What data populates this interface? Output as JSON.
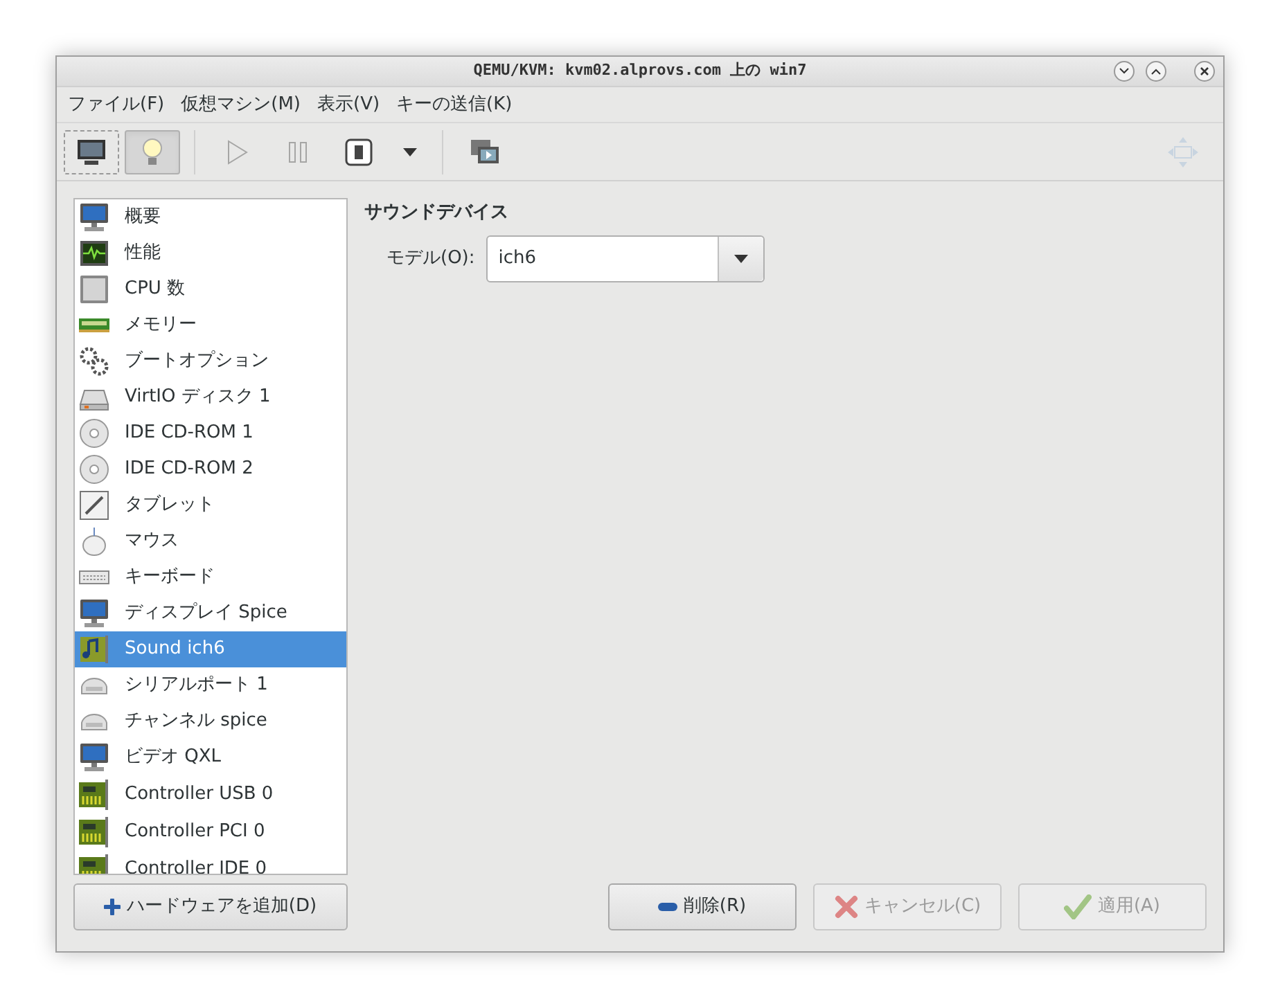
{
  "window": {
    "title": "QEMU/KVM: kvm02.alprovs.com 上の win7"
  },
  "menu": [
    "ファイル(F)",
    "仮想マシン(M)",
    "表示(V)",
    "キーの送信(K)"
  ],
  "toolbar": [
    {
      "kind": "console",
      "selected": false,
      "disabled": false
    },
    {
      "kind": "details",
      "selected": true,
      "disabled": false
    },
    {
      "kind": "run",
      "selected": false,
      "disabled": true
    },
    {
      "kind": "pause",
      "selected": false,
      "disabled": true
    },
    {
      "kind": "shutdown",
      "selected": false,
      "disabled": false
    },
    {
      "kind": "dropdown",
      "selected": false,
      "disabled": false
    },
    {
      "kind": "snapshots",
      "selected": false,
      "disabled": false
    },
    {
      "kind": "fullscreen",
      "selected": false,
      "disabled": true
    }
  ],
  "hardware": [
    {
      "label": "概要",
      "kind": "monitor",
      "selected": false
    },
    {
      "label": "性能",
      "kind": "graph",
      "selected": false
    },
    {
      "label": "CPU 数",
      "kind": "chip",
      "selected": false
    },
    {
      "label": "メモリー",
      "kind": "memory",
      "selected": false
    },
    {
      "label": "ブートオプション",
      "kind": "gears",
      "selected": false
    },
    {
      "label": "VirtIO ディスク 1",
      "kind": "disk",
      "selected": false
    },
    {
      "label": "IDE CD-ROM 1",
      "kind": "cdrom",
      "selected": false
    },
    {
      "label": "IDE CD-ROM 2",
      "kind": "cdrom",
      "selected": false
    },
    {
      "label": "タブレット",
      "kind": "tablet",
      "selected": false
    },
    {
      "label": "マウス",
      "kind": "mouse",
      "selected": false
    },
    {
      "label": "キーボード",
      "kind": "keyboard",
      "selected": false
    },
    {
      "label": "ディスプレイ Spice",
      "kind": "monitor",
      "selected": false
    },
    {
      "label": "Sound ich6",
      "kind": "sound",
      "selected": true
    },
    {
      "label": "シリアルポート 1",
      "kind": "serial",
      "selected": false
    },
    {
      "label": "チャンネル spice",
      "kind": "serial",
      "selected": false
    },
    {
      "label": "ビデオ QXL",
      "kind": "monitor",
      "selected": false
    },
    {
      "label": "Controller USB 0",
      "kind": "card",
      "selected": false
    },
    {
      "label": "Controller PCI 0",
      "kind": "card",
      "selected": false
    },
    {
      "label": "Controller IDE 0",
      "kind": "card",
      "selected": false
    }
  ],
  "add_button": {
    "label": "ハードウェアを追加(D)",
    "disabled": false
  },
  "detail": {
    "heading": "サウンドデバイス",
    "model_label": "モデル(O):",
    "model_value": "ich6"
  },
  "buttons": [
    {
      "label": "削除(R)",
      "kind": "remove",
      "disabled": false
    },
    {
      "label": "キャンセル(C)",
      "kind": "cancel",
      "disabled": true
    },
    {
      "label": "適用(A)",
      "kind": "apply",
      "disabled": true
    }
  ]
}
